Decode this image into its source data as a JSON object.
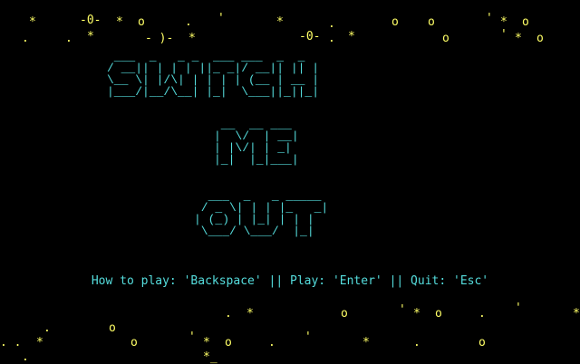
{
  "colors": {
    "background": "#000000",
    "title": "#55dddd",
    "instructions": "#55dddd",
    "stars": "#ffff66"
  },
  "title_text": "SWITCH ME OUT",
  "title_art": {
    "switch": " ___  _   _ _  ___ ___  _  _\n/ __|| | | | ||_ _|/ __|| || |\n\\__ \\| |/\\| | | | | (__ | __ |\n|___/|__/\\__| |_|  \\___||_||_|",
    "me": " __  __ ___\n|  \\/  | __|\n| |\\/| | _|\n|_|  |_|___|",
    "out": "  ___  _   _ _____\n / _ \\| | | |_   _|\n| (_) | |_| | | |\n \\___/ \\___/  |_|"
  },
  "instructions": "How to play: 'Backspace' || Play: 'Enter' || Quit: 'Esc'",
  "stars": [
    {
      "glyph": "*"
    },
    {
      "glyph": "-0-"
    },
    {
      "glyph": "*"
    },
    {
      "glyph": "o"
    },
    {
      "glyph": "."
    },
    {
      "glyph": "'"
    },
    {
      "glyph": "*"
    },
    {
      "glyph": "."
    },
    {
      "glyph": "o"
    },
    {
      "glyph": "o"
    },
    {
      "glyph": "'"
    },
    {
      "glyph": "*"
    },
    {
      "glyph": "o"
    },
    {
      "glyph": "."
    },
    {
      "glyph": "."
    },
    {
      "glyph": "*"
    },
    {
      "glyph": "- )-"
    },
    {
      "glyph": "*"
    },
    {
      "glyph": "-0-"
    },
    {
      "glyph": "."
    },
    {
      "glyph": "*"
    },
    {
      "glyph": "o"
    },
    {
      "glyph": "'"
    },
    {
      "glyph": "*"
    },
    {
      "glyph": "o"
    },
    {
      "glyph": "."
    },
    {
      "glyph": "*"
    },
    {
      "glyph": "o"
    },
    {
      "glyph": "'"
    },
    {
      "glyph": "*"
    },
    {
      "glyph": "o"
    },
    {
      "glyph": "."
    },
    {
      "glyph": "'"
    },
    {
      "glyph": "*"
    },
    {
      "glyph": "."
    },
    {
      "glyph": "o"
    },
    {
      "glyph": ". ."
    },
    {
      "glyph": "*"
    },
    {
      "glyph": "o"
    },
    {
      "glyph": "'"
    },
    {
      "glyph": "*"
    },
    {
      "glyph": "o"
    },
    {
      "glyph": "."
    },
    {
      "glyph": "'"
    },
    {
      "glyph": "*"
    },
    {
      "glyph": "."
    },
    {
      "glyph": "o"
    },
    {
      "glyph": "."
    },
    {
      "glyph": "*_"
    }
  ]
}
